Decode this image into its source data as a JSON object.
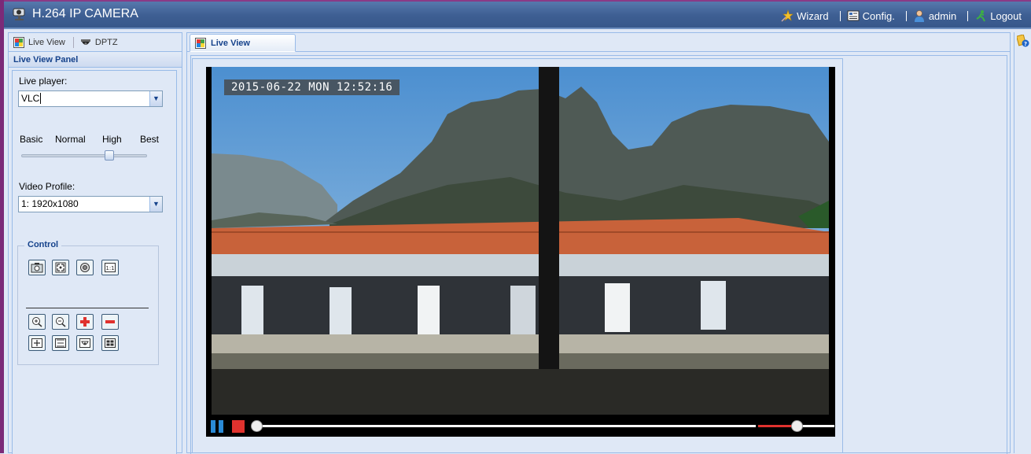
{
  "header": {
    "title": "H.264 IP CAMERA",
    "nav": [
      {
        "label": "Wizard",
        "icon": "wizard-star-icon"
      },
      {
        "label": "Config.",
        "icon": "config-icon"
      },
      {
        "label": "admin",
        "icon": "user-icon"
      },
      {
        "label": "Logout",
        "icon": "logout-icon"
      }
    ]
  },
  "sidebar": {
    "tabs": [
      {
        "label": "Live View",
        "icon": "live-view-icon"
      },
      {
        "label": "DPTZ",
        "icon": "dome-camera-icon"
      }
    ],
    "panel_title": "Live View Panel",
    "live_player_label": "Live player:",
    "live_player_value": "VLC",
    "quality_levels": [
      "Basic",
      "Normal",
      "High",
      "Best"
    ],
    "quality_selected": "High",
    "video_profile_label": "Video Profile:",
    "video_profile_value": "1: 1920x1080",
    "control_legend": "Control"
  },
  "main": {
    "tab_label": "Live View",
    "timestamp": "2015-06-22 MON 12:52:16",
    "player": {
      "seek_progress": 0.0,
      "volume": 0.5
    }
  },
  "colors": {
    "header_bg": "#3e5f93",
    "panel_bg": "#dfe8f6",
    "border": "#99bbe8",
    "title_blue": "#15428b",
    "pause_blue": "#2a8ad6",
    "stop_red": "#e0322e"
  }
}
